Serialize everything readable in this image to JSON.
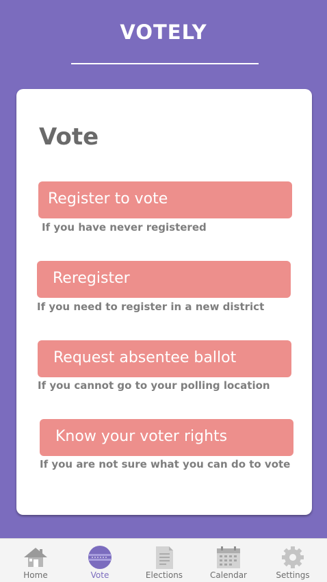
{
  "app": {
    "title": "VOTELY"
  },
  "card": {
    "title": "Vote"
  },
  "options": [
    {
      "label": "Register to vote",
      "description": "If you have never registered"
    },
    {
      "label": "Reregister",
      "description": "If you need to register in a new district"
    },
    {
      "label": "Request absentee ballot",
      "description": "If you cannot go to your polling location"
    },
    {
      "label": "Know your voter rights",
      "description": "If you are not sure what you can do to vote"
    }
  ],
  "tabs": [
    {
      "label": "Home",
      "icon": "home-icon"
    },
    {
      "label": "Vote",
      "icon": "ballot-icon",
      "active": true
    },
    {
      "label": "Elections",
      "icon": "document-icon"
    },
    {
      "label": "Calendar",
      "icon": "calendar-icon"
    },
    {
      "label": "Settings",
      "icon": "gear-icon"
    }
  ],
  "colors": {
    "background": "#7b6cbe",
    "button": "#ed8f8c",
    "card": "#ffffff"
  }
}
